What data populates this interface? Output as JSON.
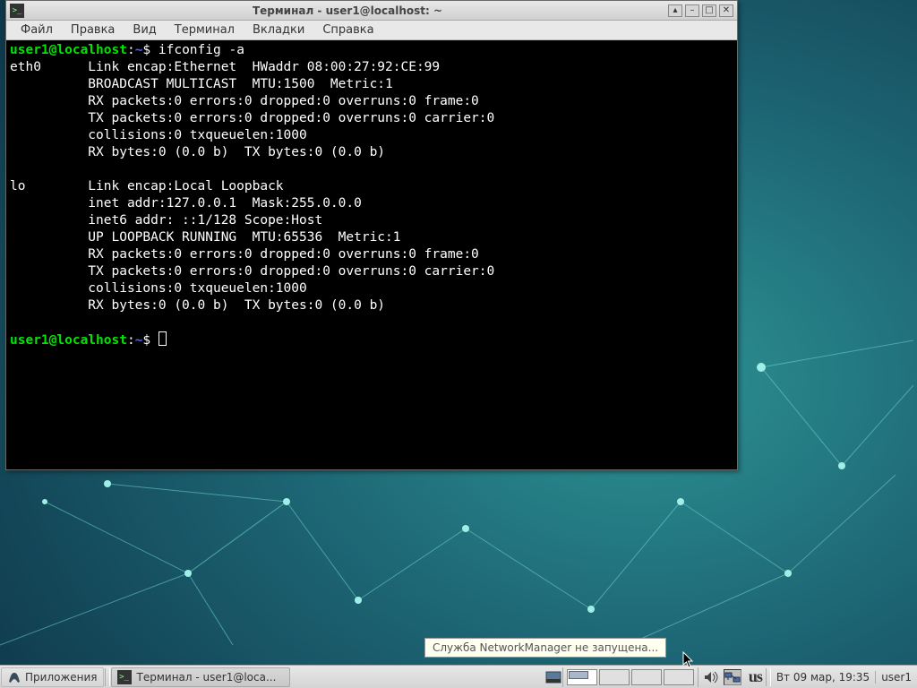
{
  "window": {
    "title": "Терминал - user1@localhost: ~",
    "menu": [
      "Файл",
      "Правка",
      "Вид",
      "Терминал",
      "Вкладки",
      "Справка"
    ]
  },
  "terminal": {
    "prompt_user": "user1@localhost",
    "prompt_path": "~",
    "prompt_sep": ":",
    "prompt_dollar": "$",
    "command": "ifconfig -a",
    "lines": [
      "eth0      Link encap:Ethernet  HWaddr 08:00:27:92:CE:99",
      "          BROADCAST MULTICAST  MTU:1500  Metric:1",
      "          RX packets:0 errors:0 dropped:0 overruns:0 frame:0",
      "          TX packets:0 errors:0 dropped:0 overruns:0 carrier:0",
      "          collisions:0 txqueuelen:1000",
      "          RX bytes:0 (0.0 b)  TX bytes:0 (0.0 b)",
      "",
      "lo        Link encap:Local Loopback",
      "          inet addr:127.0.0.1  Mask:255.0.0.0",
      "          inet6 addr: ::1/128 Scope:Host",
      "          UP LOOPBACK RUNNING  MTU:65536  Metric:1",
      "          RX packets:0 errors:0 dropped:0 overruns:0 frame:0",
      "          TX packets:0 errors:0 dropped:0 overruns:0 carrier:0",
      "          collisions:0 txqueuelen:1000",
      "          RX bytes:0 (0.0 b)  TX bytes:0 (0.0 b)",
      ""
    ]
  },
  "tooltip": "Служба NetworkManager не запущена...",
  "taskbar": {
    "start_label": "Приложения",
    "task_label": "Терминал - user1@loca...",
    "keyboard_indicator": "us",
    "clock": "Вт 09 мар, 19:35",
    "user": "user1"
  }
}
